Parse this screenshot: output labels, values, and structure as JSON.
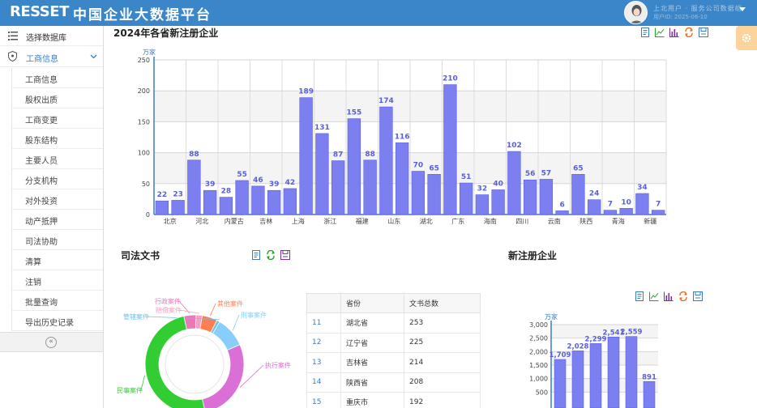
{
  "header": {
    "logo": "RESSET",
    "title": "中国企业大数据平台",
    "user_line1": "上北用户 · 服务公司数据组",
    "user_line2": "用户ID: 2025-06-10"
  },
  "sidebar": {
    "select_db": "选择数据库",
    "group": "工商信息",
    "items": [
      {
        "label": "工商信息"
      },
      {
        "label": "股权出质"
      },
      {
        "label": "工商变更"
      },
      {
        "label": "股东结构"
      },
      {
        "label": "主要人员"
      },
      {
        "label": "分支机构"
      },
      {
        "label": "对外投资"
      },
      {
        "label": "动产抵押"
      },
      {
        "label": "司法协助"
      },
      {
        "label": "清算"
      },
      {
        "label": "注销"
      },
      {
        "label": "批量查询"
      },
      {
        "label": "导出历史记录"
      }
    ],
    "collapse_glyph": "«"
  },
  "sections": {
    "province_title": "2024年各省新注册企业",
    "judicial_title": "司法文书",
    "newreg_title": "新注册企业"
  },
  "table": {
    "headers": [
      "",
      "省份",
      "文书总数"
    ],
    "rows": [
      {
        "idx": "11",
        "province": "湖北省",
        "count": "253"
      },
      {
        "idx": "12",
        "province": "辽宁省",
        "count": "225"
      },
      {
        "idx": "13",
        "province": "吉林省",
        "count": "214"
      },
      {
        "idx": "14",
        "province": "陕西省",
        "count": "208"
      },
      {
        "idx": "15",
        "province": "重庆市",
        "count": "192"
      }
    ]
  },
  "colors": {
    "header": "#3b86c8",
    "bar": "#7b7ff0",
    "bar_stroke": "#5b60e0",
    "label": "#5a5fd8",
    "accent": "#3a7cc4"
  },
  "chart_data": [
    {
      "type": "bar",
      "title": "2024年各省新注册企业",
      "ylabel": "万家",
      "ylim": [
        0,
        250
      ],
      "yticks": [
        0,
        50,
        100,
        150,
        200,
        250
      ],
      "grid": true,
      "categories": [
        "北京",
        "天津",
        "河北",
        "山西",
        "内蒙古",
        "辽宁",
        "吉林",
        "黑龙江",
        "上海",
        "江苏",
        "浙江",
        "安徽",
        "福建",
        "江西",
        "山东",
        "河南",
        "湖北",
        "湖南",
        "广东",
        "广西",
        "海南",
        "重庆",
        "四川",
        "贵州",
        "云南",
        "西藏",
        "陕西",
        "甘肃",
        "青海",
        "宁夏",
        "新疆",
        "新疆兵团"
      ],
      "xtick_labels": [
        "北京",
        "",
        "河北",
        "",
        "内蒙古",
        "",
        "吉林",
        "",
        "上海",
        "",
        "浙江",
        "",
        "福建",
        "",
        "山东",
        "",
        "湖北",
        "",
        "广东",
        "",
        "海南",
        "",
        "四川",
        "",
        "云南",
        "",
        "陕西",
        "",
        "青海",
        "",
        "新疆",
        ""
      ],
      "values": [
        22,
        23,
        88,
        39,
        28,
        55,
        46,
        39,
        42,
        189,
        131,
        87,
        155,
        88,
        174,
        116,
        70,
        65,
        210,
        51,
        32,
        40,
        102,
        56,
        57,
        6,
        65,
        24,
        7,
        10,
        34,
        7
      ]
    },
    {
      "type": "pie",
      "title": "司法文书",
      "donut": true,
      "legend_labels": [
        "行政案件",
        "赔偿案件",
        "其他案件",
        "管辖案件",
        "刑事案件",
        "执行案件",
        "民事案件"
      ],
      "values": [
        4,
        2,
        5,
        1,
        10,
        28,
        50
      ],
      "colors": [
        "#e879b9",
        "#f5a0c0",
        "#ff7f50",
        "#6fc2e8",
        "#87cefa",
        "#da70d6",
        "#32cd32"
      ]
    },
    {
      "type": "bar",
      "title": "新注册企业",
      "ylabel": "万家",
      "ylim": [
        0,
        3000
      ],
      "yticks": [
        "500",
        "1,000",
        "1,500",
        "2,000",
        "2,500",
        "3,000"
      ],
      "grid": true,
      "categories": [
        "",
        "",
        "",
        "",
        "",
        ""
      ],
      "value_labels": [
        "1,709",
        "2,028",
        "2,299",
        "2,541",
        "2,559",
        "891"
      ],
      "values": [
        1709,
        2028,
        2299,
        2541,
        2559,
        891
      ]
    }
  ]
}
